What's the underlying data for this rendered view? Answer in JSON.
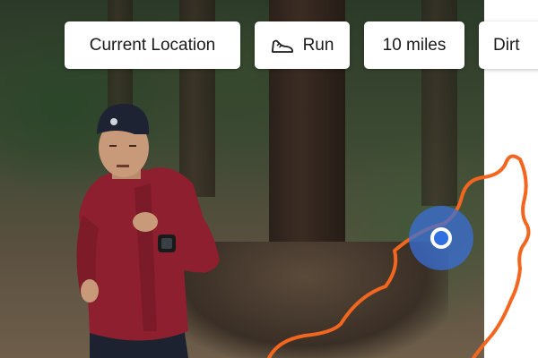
{
  "filters": {
    "location_label": "Current Location",
    "activity_label": "Run",
    "activity_icon": "shoe-icon",
    "distance_label": "10 miles",
    "surface_label": "Dirt"
  },
  "colors": {
    "route": "#f2661f",
    "location_halo": "#3a6fd8",
    "location_dot": "#2f6fe0",
    "chip_background": "#ffffff"
  }
}
